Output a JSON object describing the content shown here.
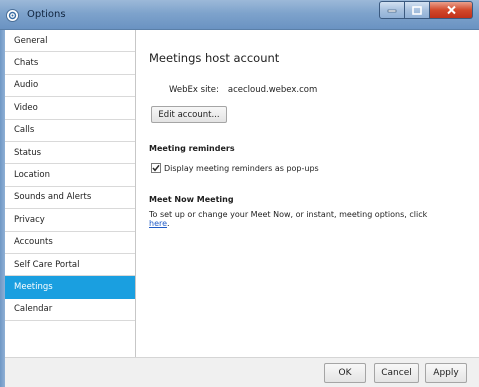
{
  "window": {
    "title": "Options",
    "icon": "options-app-icon",
    "controls": [
      "minimize-icon",
      "maximize-icon",
      "close-icon"
    ]
  },
  "sidebar": {
    "items": [
      {
        "label": "General"
      },
      {
        "label": "Chats"
      },
      {
        "label": "Audio"
      },
      {
        "label": "Video"
      },
      {
        "label": "Calls"
      },
      {
        "label": "Status"
      },
      {
        "label": "Location"
      },
      {
        "label": "Sounds and Alerts"
      },
      {
        "label": "Privacy"
      },
      {
        "label": "Accounts"
      },
      {
        "label": "Self Care Portal"
      },
      {
        "label": "Meetings"
      },
      {
        "label": "Calendar"
      }
    ],
    "selected": "Meetings",
    "selected_color": "#1a9fe0"
  },
  "main": {
    "title": "Meetings host account",
    "site_label": "WebEx site:",
    "site_value": "acecloud.webex.com",
    "edit_button": "Edit account...",
    "reminders_heading": "Meeting reminders",
    "reminders_checkbox": {
      "label": "Display meeting reminders as pop-ups",
      "checked": true
    },
    "meetnow_heading": "Meet Now Meeting",
    "meetnow_text": "To set up or change your Meet Now, or instant, meeting options, click",
    "meetnow_link": "here",
    "meetnow_period": "."
  },
  "footer": {
    "ok": "OK",
    "cancel": "Cancel",
    "apply": "Apply"
  }
}
